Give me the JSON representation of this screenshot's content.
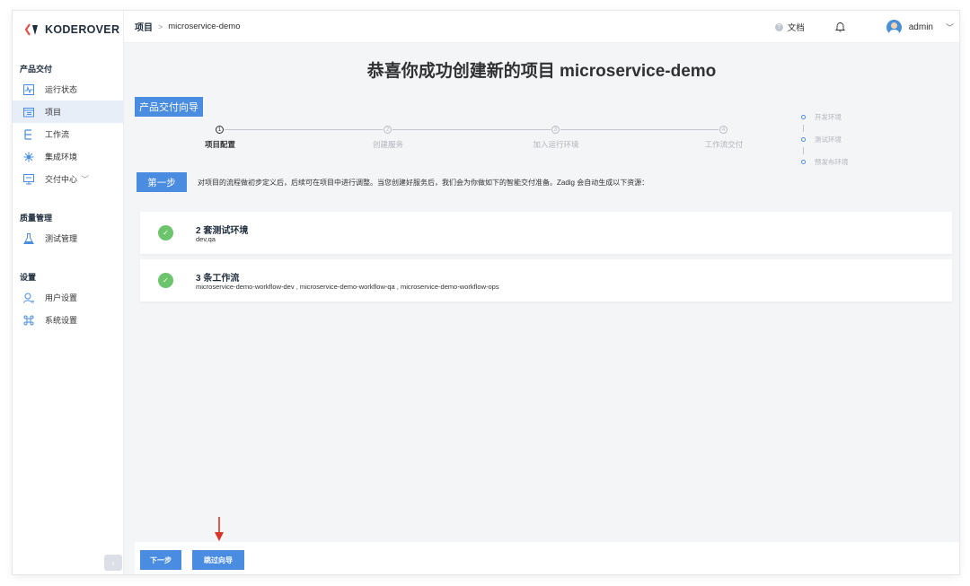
{
  "app": {
    "logo_text": "KODEROVER",
    "brand_color": "#4a8ce0"
  },
  "sidebar": {
    "sections": [
      {
        "title": "产品交付",
        "items": [
          {
            "label": "运行状态",
            "icon": "pulse-icon"
          },
          {
            "label": "项目",
            "icon": "project-icon",
            "active": true
          },
          {
            "label": "工作流",
            "icon": "workflow-icon"
          },
          {
            "label": "集成环境",
            "icon": "environment-icon"
          },
          {
            "label": "交付中心",
            "icon": "delivery-icon",
            "has_submenu": true
          }
        ]
      },
      {
        "title": "质量管理",
        "items": [
          {
            "label": "测试管理",
            "icon": "flask-icon"
          }
        ]
      },
      {
        "title": "设置",
        "items": [
          {
            "label": "用户设置",
            "icon": "user-icon"
          },
          {
            "label": "系统设置",
            "icon": "command-icon"
          }
        ]
      }
    ],
    "collapse_label": "‹"
  },
  "header": {
    "breadcrumb_root": "项目",
    "breadcrumb_sep": ">",
    "breadcrumb_leaf": "microservice-demo",
    "docs_label": "文档",
    "username": "admin"
  },
  "main": {
    "title": "恭喜你成功创建新的项目 microservice-demo",
    "guide_tag": "产品交付向导",
    "steps": [
      {
        "num": "1",
        "label": "项目配置",
        "active": true
      },
      {
        "num": "2",
        "label": "创建服务",
        "active": false
      },
      {
        "num": "3",
        "label": "加入运行环境",
        "active": false
      },
      {
        "num": "4",
        "label": "工作流交付",
        "active": false
      }
    ],
    "envs": [
      "开发环境",
      "测试环境",
      "预发布环境"
    ],
    "step_badge": "第一步",
    "step_desc": "对项目的流程做初步定义后，后续可在项目中进行调整。当您创建好服务后，我们会为你做如下的智能交付准备。Zadig 会自动生成以下资源：",
    "cards": [
      {
        "title": "2 套测试环境",
        "sub": "dev,qa"
      },
      {
        "title": "3 条工作流",
        "sub": "microservice-demo-workflow-dev , microservice-demo-workflow-qa , microservice-demo-workflow-ops"
      }
    ]
  },
  "footer": {
    "next_label": "下一步",
    "skip_label": "跳过向导"
  }
}
